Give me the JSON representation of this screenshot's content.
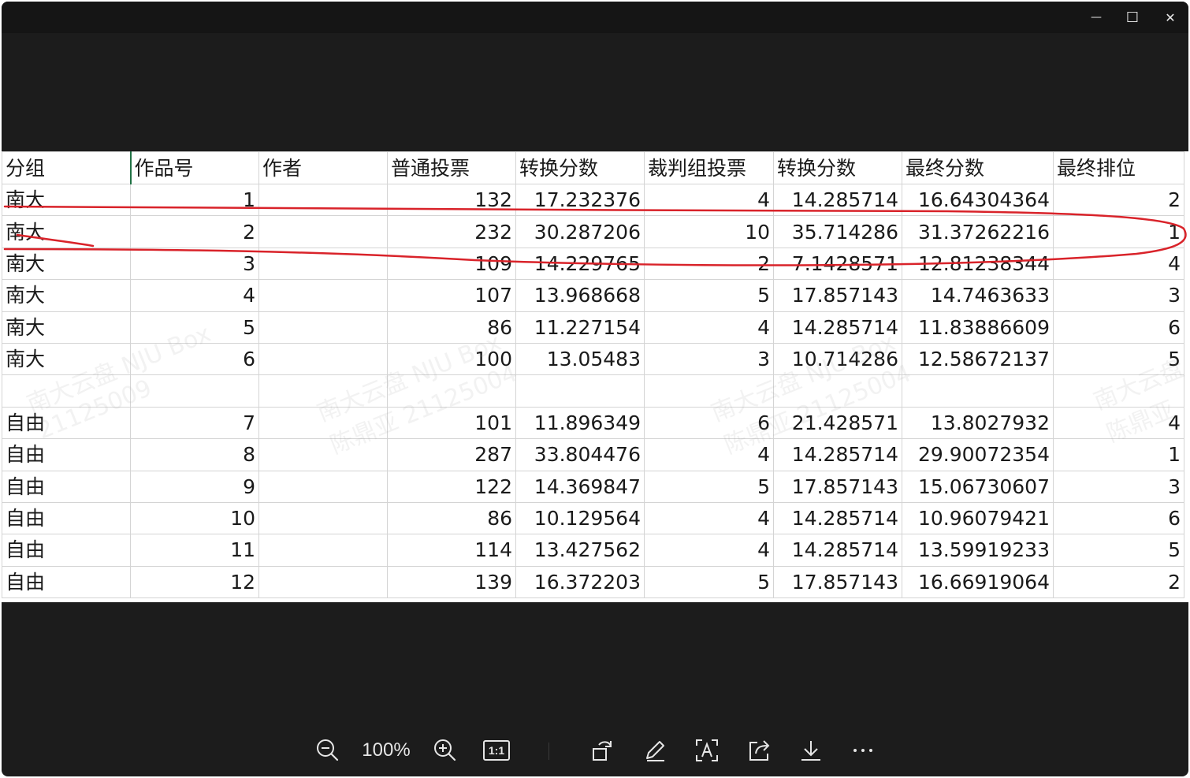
{
  "window": {
    "controls": {
      "minimize": "—",
      "maximize": "☐",
      "close": "✕"
    }
  },
  "sheet": {
    "headers": [
      "分组",
      "作品号",
      "作者",
      "普通投票",
      "转换分数",
      "裁判组投票",
      "转换分数",
      "最终分数",
      "最终排位"
    ],
    "rows": [
      [
        "南大",
        "1",
        "",
        "132",
        "17.232376",
        "4",
        "14.285714",
        "16.64304364",
        "2"
      ],
      [
        "南大",
        "2",
        "",
        "232",
        "30.287206",
        "10",
        "35.714286",
        "31.37262216",
        "1"
      ],
      [
        "南大",
        "3",
        "",
        "109",
        "14.229765",
        "2",
        "7.1428571",
        "12.81238344",
        "4"
      ],
      [
        "南大",
        "4",
        "",
        "107",
        "13.968668",
        "5",
        "17.857143",
        "14.7463633",
        "3"
      ],
      [
        "南大",
        "5",
        "",
        "86",
        "11.227154",
        "4",
        "14.285714",
        "11.83886609",
        "6"
      ],
      [
        "南大",
        "6",
        "",
        "100",
        "13.05483",
        "3",
        "10.714286",
        "12.58672137",
        "5"
      ],
      [
        "",
        "",
        "",
        "",
        "",
        "",
        "",
        "",
        ""
      ],
      [
        "自由",
        "7",
        "",
        "101",
        "11.896349",
        "6",
        "21.428571",
        "13.8027932",
        "4"
      ],
      [
        "自由",
        "8",
        "",
        "287",
        "33.804476",
        "4",
        "14.285714",
        "29.90072354",
        "1"
      ],
      [
        "自由",
        "9",
        "",
        "122",
        "14.369847",
        "5",
        "17.857143",
        "15.06730607",
        "3"
      ],
      [
        "自由",
        "10",
        "",
        "86",
        "10.129564",
        "4",
        "14.285714",
        "10.96079421",
        "6"
      ],
      [
        "自由",
        "11",
        "",
        "114",
        "13.427562",
        "4",
        "14.285714",
        "13.59919233",
        "5"
      ],
      [
        "自由",
        "12",
        "",
        "139",
        "16.372203",
        "5",
        "17.857143",
        "16.66919064",
        "2"
      ]
    ]
  },
  "watermarks": [
    {
      "line1": "南大云盘 NJU Box",
      "line2": "21125009"
    },
    {
      "line1": "南大云盘 NJU Box",
      "line2": "陈鼎亚 21125004"
    },
    {
      "line1": "南大云盘 NJU Box",
      "line2": "陈鼎亚 21125004"
    },
    {
      "line1": "南大云盘",
      "line2": "陈鼎亚"
    }
  ],
  "toolbar": {
    "zoom_out_icon": "zoom-out",
    "zoom_level": "100%",
    "zoom_in_icon": "zoom-in",
    "actual_size_label": "1:1",
    "rotate_icon": "rotate",
    "edit_icon": "pencil",
    "ocr_icon": "text-recognition",
    "share_icon": "share",
    "save_icon": "download",
    "more_icon": "more"
  },
  "colors": {
    "annotation": "#d9232a",
    "toolbar_icon": "#e6e6e6",
    "selection": "#217346"
  }
}
